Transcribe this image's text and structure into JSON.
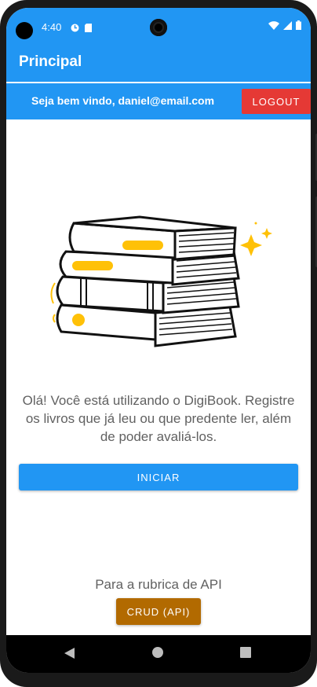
{
  "status_bar": {
    "time": "4:40",
    "left_icons": [
      "data-saver-icon",
      "sd-card-icon"
    ],
    "right_icons": [
      "wifi-icon",
      "signal-icon",
      "battery-icon"
    ]
  },
  "app_bar": {
    "title": "Principal"
  },
  "welcome_bar": {
    "greeting": "Seja bem vindo, daniel@email.com",
    "logout_label": "LOGOUT"
  },
  "main": {
    "illustration": "books-stack-illustration",
    "message": "Olá! Você está utilizando o DigiBook. Registre os livros que já leu ou que predente ler, além de poder avaliá-los.",
    "start_button_label": "INICIAR",
    "api_caption": "Para a rubrica de API",
    "crud_button_label": "CRUD (API)"
  },
  "nav_bar": {
    "icons": [
      "back-icon",
      "home-icon",
      "recents-icon"
    ]
  },
  "colors": {
    "primary": "#2196f3",
    "logout": "#e53935",
    "crud": "#b26a00",
    "book_accent": "#ffc107"
  }
}
